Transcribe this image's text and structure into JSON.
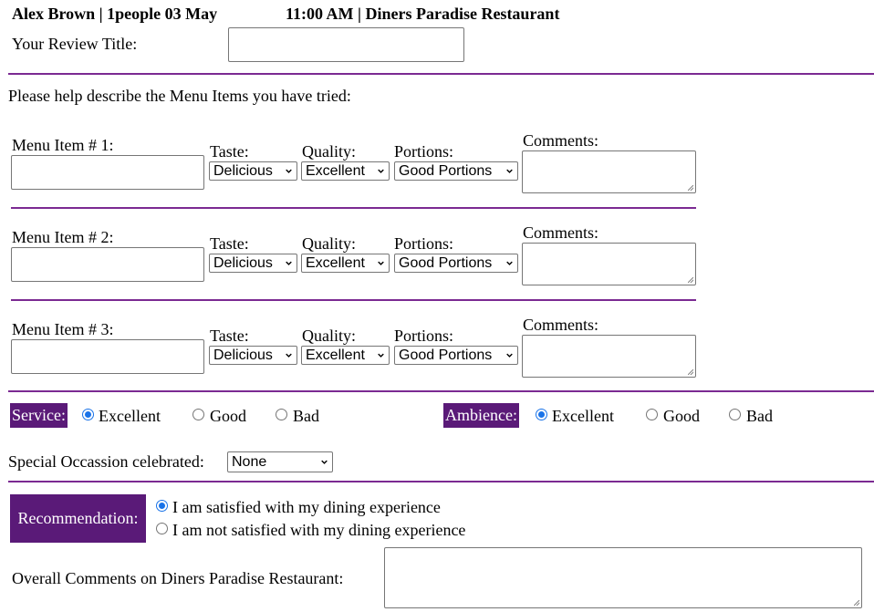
{
  "header": {
    "left": "Alex Brown | 1people 03 May",
    "right": "11:00 AM | Diners Paradise Restaurant"
  },
  "review_title": {
    "label": "Your Review Title:",
    "value": ""
  },
  "menu_intro": "Please help describe the Menu Items you have tried:",
  "labels": {
    "taste": "Taste:",
    "quality": "Quality:",
    "portions": "Portions:",
    "comments": "Comments:"
  },
  "menu_items": [
    {
      "label": "Menu Item # 1:",
      "value": "",
      "taste": "Delicious",
      "quality": "Excellent",
      "portions": "Good Portions",
      "comments": ""
    },
    {
      "label": "Menu Item # 2:",
      "value": "",
      "taste": "Delicious",
      "quality": "Excellent",
      "portions": "Good Portions",
      "comments": ""
    },
    {
      "label": "Menu Item # 3:",
      "value": "",
      "taste": "Delicious",
      "quality": "Excellent",
      "portions": "Good Portions",
      "comments": ""
    }
  ],
  "service": {
    "label": "Service:",
    "options": [
      "Excellent",
      "Good",
      "Bad"
    ],
    "selected": "Excellent"
  },
  "ambience": {
    "label": "Ambience:",
    "options": [
      "Excellent",
      "Good",
      "Bad"
    ],
    "selected": "Excellent"
  },
  "special_occasion": {
    "label": "Special Occassion celebrated:",
    "value": "None"
  },
  "recommendation": {
    "label": "Recommendation:",
    "options": [
      "I am satisfied with my dining experience",
      "I am not satisfied with my dining experience"
    ],
    "selected": "I am satisfied with my dining experience"
  },
  "overall_comments": {
    "label": "Overall Comments on Diners Paradise Restaurant:",
    "value": ""
  },
  "colors": {
    "accent": "#7b2a92",
    "badge_bg": "#5a1a78",
    "radio_selected": "#1a73e8"
  }
}
